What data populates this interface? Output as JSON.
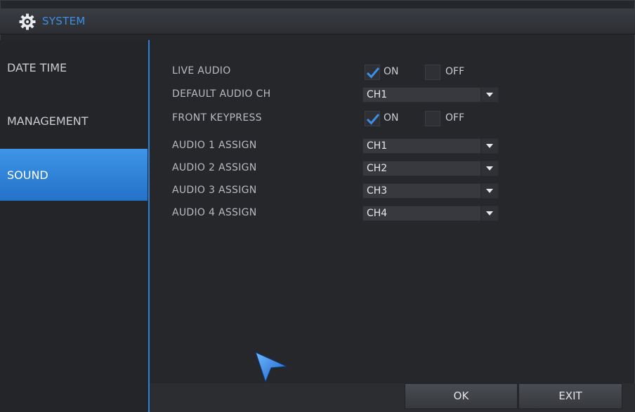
{
  "window": {
    "title": "SYSTEM",
    "title_icon": "gear-icon"
  },
  "sidebar": {
    "items": [
      {
        "label": "DATE TIME",
        "active": false
      },
      {
        "label": "MANAGEMENT",
        "active": false
      },
      {
        "label": "SOUND",
        "active": true
      }
    ]
  },
  "settings": {
    "live_audio": {
      "label": "LIVE AUDIO",
      "on_label": "ON",
      "off_label": "OFF",
      "value": "ON"
    },
    "default_audio_ch": {
      "label": "DEFAULT AUDIO CH",
      "value": "CH1"
    },
    "front_keypress": {
      "label": "FRONT KEYPRESS",
      "on_label": "ON",
      "off_label": "OFF",
      "value": "ON"
    },
    "audio_assign": [
      {
        "label": "AUDIO 1 ASSIGN",
        "value": "CH1"
      },
      {
        "label": "AUDIO 2 ASSIGN",
        "value": "CH2"
      },
      {
        "label": "AUDIO 3 ASSIGN",
        "value": "CH3"
      },
      {
        "label": "AUDIO 4 ASSIGN",
        "value": "CH4"
      }
    ]
  },
  "footer": {
    "ok_label": "OK",
    "exit_label": "EXIT"
  },
  "colors": {
    "accent": "#2f7fd6",
    "title_text": "#3d8ee6",
    "active_item": "#3f95e8"
  }
}
